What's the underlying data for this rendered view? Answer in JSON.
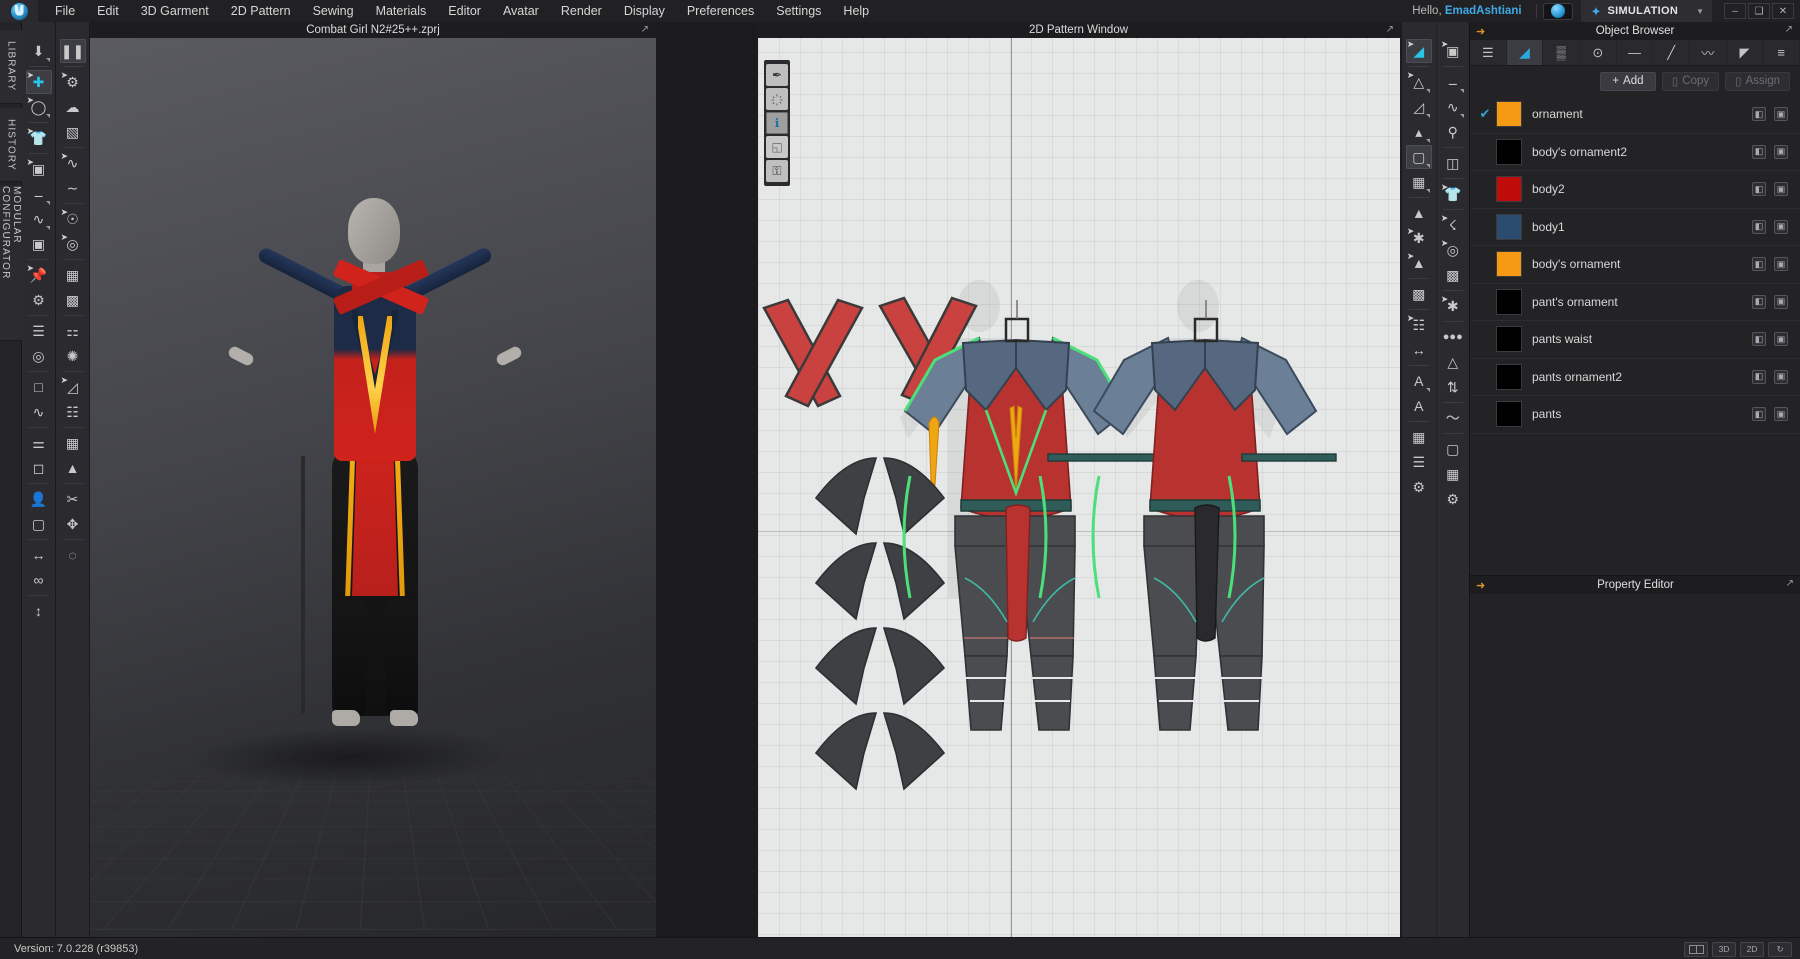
{
  "app": {
    "logo_icon": "clo-logo-icon",
    "version_text": "Version: 7.0.228 (r39853)"
  },
  "menubar": {
    "items": [
      {
        "label": "File"
      },
      {
        "label": "Edit"
      },
      {
        "label": "3D Garment"
      },
      {
        "label": "2D Pattern"
      },
      {
        "label": "Sewing"
      },
      {
        "label": "Materials"
      },
      {
        "label": "Editor"
      },
      {
        "label": "Avatar"
      },
      {
        "label": "Render"
      },
      {
        "label": "Display"
      },
      {
        "label": "Preferences"
      },
      {
        "label": "Settings"
      },
      {
        "label": "Help"
      }
    ]
  },
  "account": {
    "greeting_prefix": "Hello, ",
    "username": "EmadAshtiani",
    "cloud_icon": "cloud-sync-icon"
  },
  "mode": {
    "icon": "simulation-icon",
    "label": "SIMULATION",
    "caret": "▼"
  },
  "window_controls": {
    "minimize": "–",
    "maximize": "❑",
    "close": "✕"
  },
  "left_rail": {
    "tabs": [
      {
        "label": "LIBRARY"
      },
      {
        "label": "HISTORY"
      },
      {
        "label": "MODULAR CONFIGURATOR"
      }
    ]
  },
  "viewport_3d": {
    "title": "Combat Girl N2#25++.zprj",
    "popout_icon": "popout-icon"
  },
  "viewport_2d": {
    "title": "2D Pattern Window",
    "popout_icon": "popout-icon",
    "overlay_tools": [
      {
        "name": "show-pins-icon",
        "glyph": "✒",
        "state": "normal"
      },
      {
        "name": "show-garment-icon",
        "glyph": "҉",
        "state": "normal"
      },
      {
        "name": "show-info-icon",
        "glyph": "ℹ",
        "state": "active"
      },
      {
        "name": "fold-arrangement-icon",
        "glyph": "◱",
        "state": "dim"
      },
      {
        "name": "lock-garment-icon",
        "glyph": "⚿",
        "state": "normal"
      }
    ]
  },
  "object_browser": {
    "title": "Object Browser",
    "pin_icon": "pin-arrow-icon",
    "popout_icon": "popout-icon",
    "tabs": [
      {
        "name": "list-tab",
        "glyph": "☰",
        "selected": false
      },
      {
        "name": "fabric-tab",
        "glyph": "◢",
        "selected": true
      },
      {
        "name": "texture-tab",
        "glyph": "▒",
        "selected": false
      },
      {
        "name": "button-tab",
        "glyph": "⊙",
        "selected": false
      },
      {
        "name": "topstitch-tab",
        "glyph": "—",
        "selected": false
      },
      {
        "name": "line-tab",
        "glyph": "╱",
        "selected": false
      },
      {
        "name": "zipper-tab",
        "glyph": "〰",
        "selected": false
      },
      {
        "name": "fold-tab",
        "glyph": "◤",
        "selected": false
      },
      {
        "name": "trim-tab",
        "glyph": "≡",
        "selected": false
      }
    ],
    "actions": {
      "add_label": "Add",
      "add_icon": "plus-icon",
      "copy_label": "Copy",
      "copy_icon": "copy-icon",
      "assign_label": "Assign",
      "assign_icon": "assign-icon"
    },
    "row_icons": {
      "fabric_icon": "fabric-swatch-icon",
      "properties_icon": "properties-icon"
    },
    "items": [
      {
        "name": "ornament",
        "color": "#F59A12",
        "checked": true
      },
      {
        "name": "body's ornament2",
        "color": "#000000",
        "checked": false
      },
      {
        "name": "body2",
        "color": "#C00B0B",
        "checked": false
      },
      {
        "name": "body1",
        "color": "#2B4C6F",
        "checked": false
      },
      {
        "name": "body's ornament",
        "color": "#F59A12",
        "checked": false
      },
      {
        "name": "pant's ornament",
        "color": "#000000",
        "checked": false
      },
      {
        "name": "pants waist",
        "color": "#000000",
        "checked": false
      },
      {
        "name": "pants ornament2",
        "color": "#000000",
        "checked": false
      },
      {
        "name": "pants",
        "color": "#000000",
        "checked": false
      }
    ]
  },
  "property_editor": {
    "title": "Property Editor",
    "pin_icon": "pin-arrow-icon",
    "popout_icon": "popout-icon"
  },
  "status_bar": {
    "version": "Version: 7.0.228 (r39853)",
    "view_buttons": [
      {
        "name": "split-view-button",
        "label": ""
      },
      {
        "name": "view-3d-button",
        "label": "3D"
      },
      {
        "name": "view-2d-button",
        "label": "2D"
      },
      {
        "name": "reset-view-button",
        "label": "↻"
      }
    ]
  },
  "colors": {
    "accent_blue": "#2FA5DD",
    "accent_orange": "#E0932A",
    "panel_bg": "#232326",
    "toolbar_bg": "#2B2B2F",
    "canvas_2d": "#E6E7E7"
  }
}
